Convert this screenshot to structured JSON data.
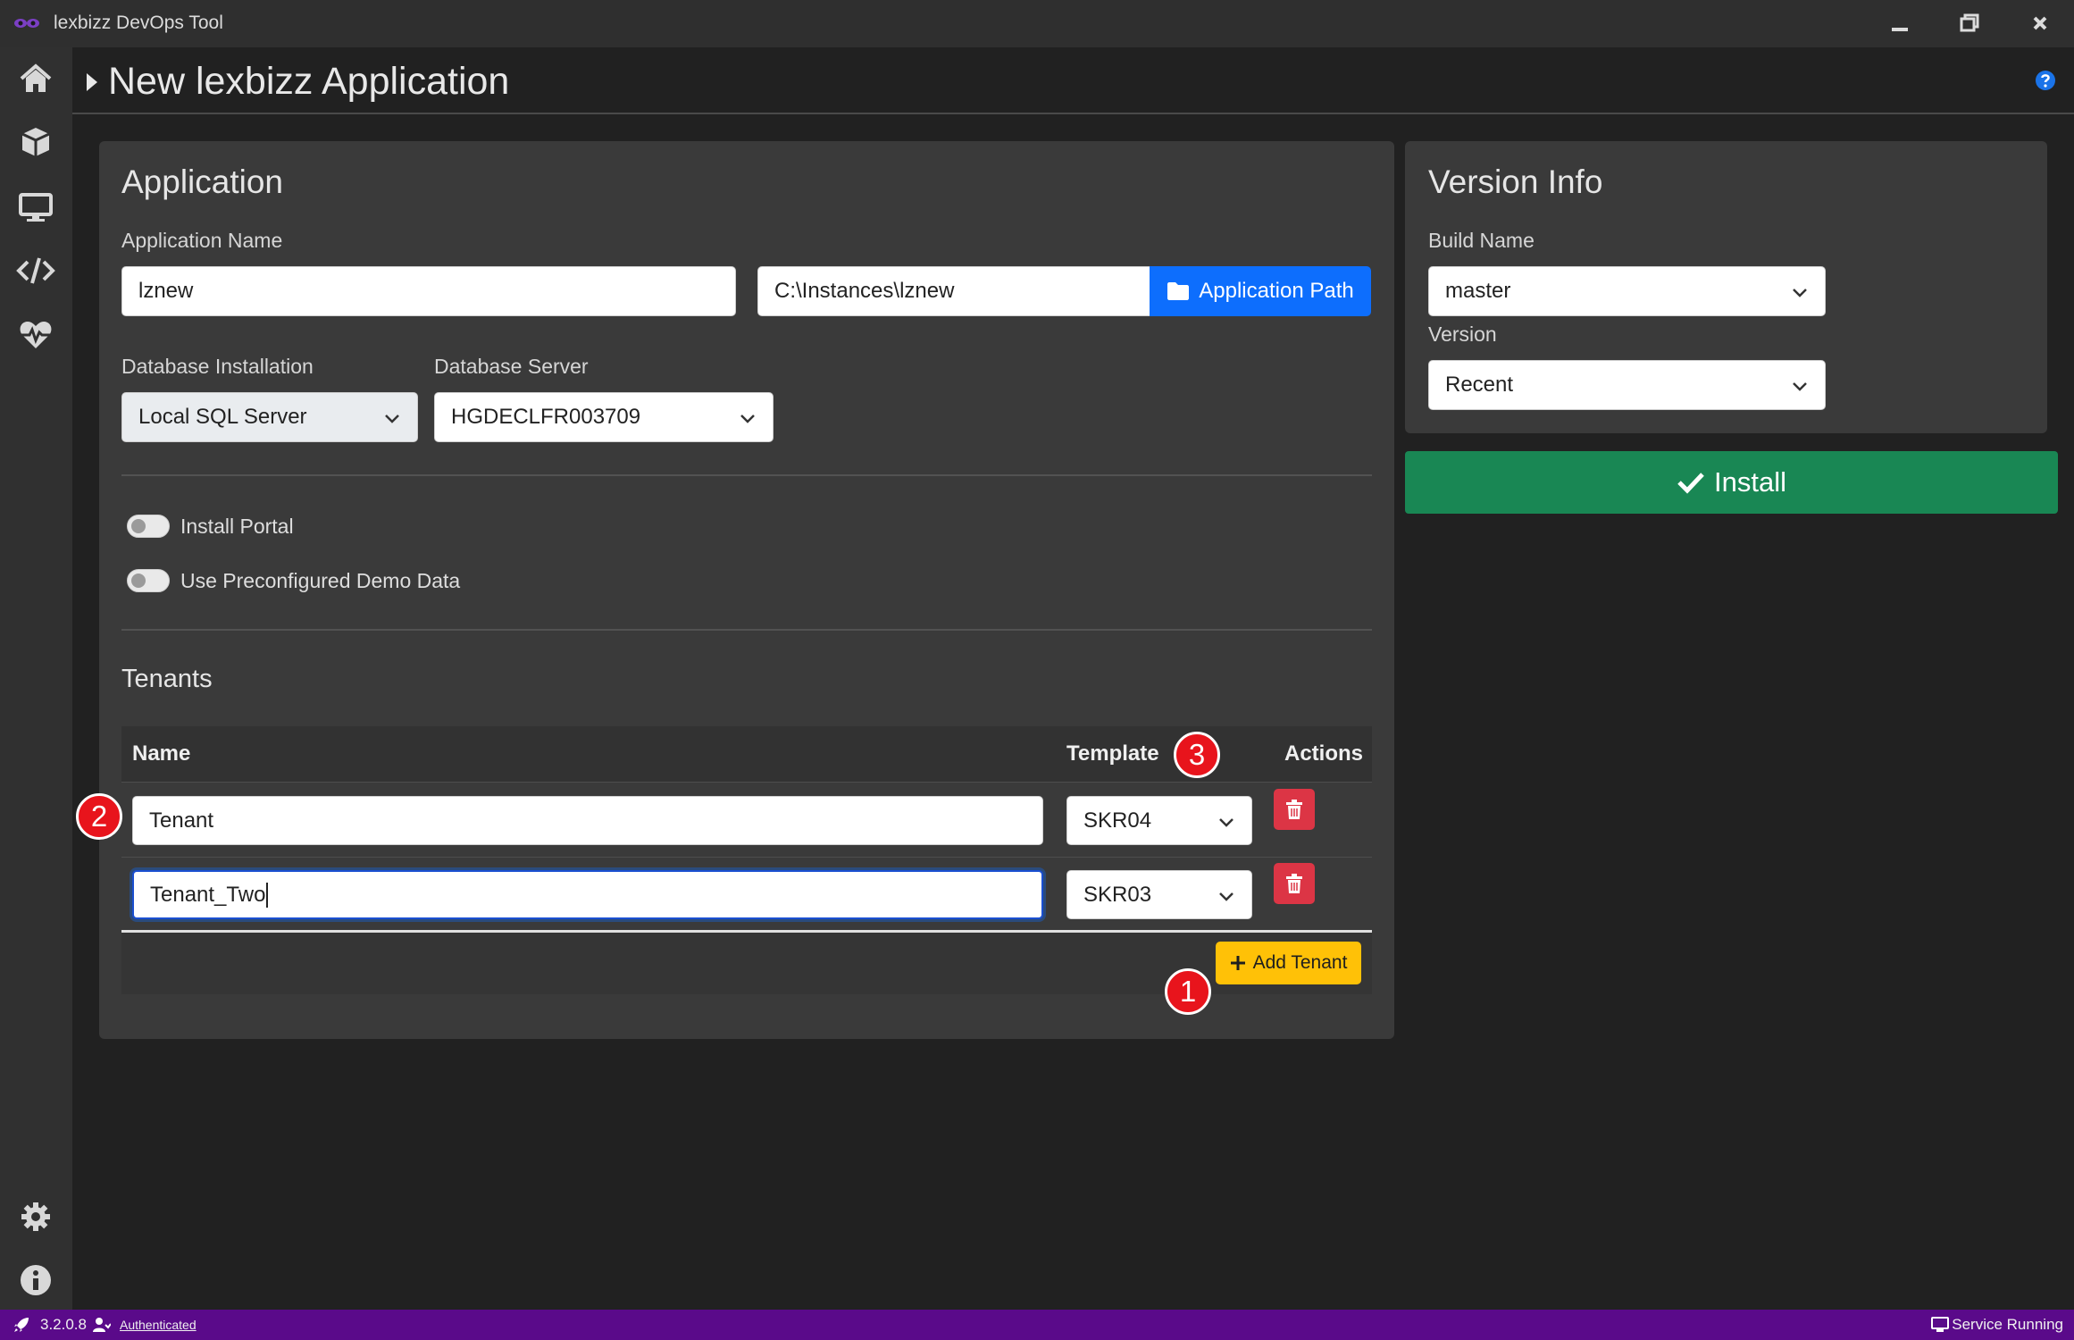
{
  "titlebar": {
    "title": "lexbizz DevOps Tool"
  },
  "sidebar": {
    "items": [
      {
        "icon": "home-icon"
      },
      {
        "icon": "cube-icon"
      },
      {
        "icon": "monitor-icon"
      },
      {
        "icon": "code-icon"
      },
      {
        "icon": "heartbeat-icon"
      },
      {
        "icon": "gear-icon"
      },
      {
        "icon": "info-icon"
      }
    ]
  },
  "header": {
    "title": "New lexbizz Application"
  },
  "application": {
    "title": "Application",
    "name_label": "Application Name",
    "name_value": "lznew",
    "path_value": "C:\\Instances\\lznew",
    "path_button": "Application Path",
    "db_install_label": "Database Installation",
    "db_install_value": "Local SQL Server",
    "db_server_label": "Database Server",
    "db_server_value": "HGDECLFR003709",
    "toggles": [
      {
        "label": "Install Portal",
        "on": false
      },
      {
        "label": "Use Preconfigured Demo Data",
        "on": false
      }
    ]
  },
  "tenants": {
    "title": "Tenants",
    "columns": [
      "Name",
      "Template",
      "Actions"
    ],
    "rows": [
      {
        "name": "Tenant",
        "template": "SKR04"
      },
      {
        "name": "Tenant_Two",
        "template": "SKR03"
      }
    ],
    "add_button": "Add Tenant"
  },
  "version_info": {
    "title": "Version Info",
    "build_label": "Build Name",
    "build_value": "master",
    "version_label": "Version",
    "version_value": "Recent"
  },
  "install_button": "Install",
  "callouts": [
    "1",
    "2",
    "3"
  ],
  "statusbar": {
    "version": "3.2.0.8",
    "auth": "Authenticated",
    "service": "Service Running"
  },
  "colors": {
    "accent_blue": "#0d6efd",
    "install_green": "#198754",
    "add_yellow": "#ffc107",
    "delete_red": "#dc3545",
    "status_purple": "#5a0a8a"
  }
}
